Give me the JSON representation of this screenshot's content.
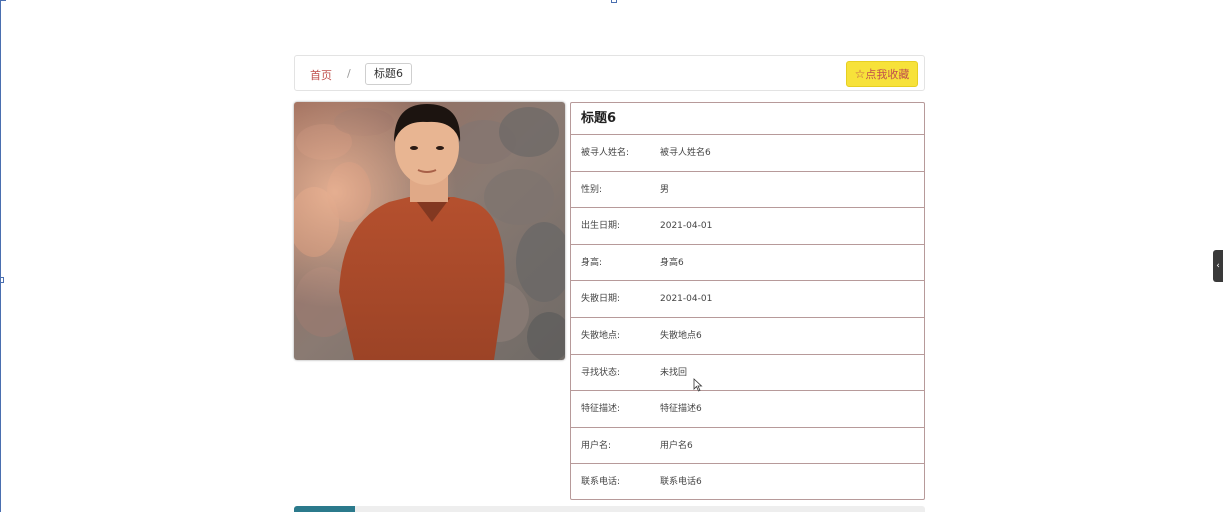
{
  "breadcrumb": {
    "home": "首页",
    "separator": "/",
    "current": "标题6"
  },
  "favorite_button": {
    "icon": "star-outline-icon",
    "label": "点我收藏"
  },
  "side_toggle": {
    "icon": "chevron-left-icon"
  },
  "detail": {
    "title": "标题6",
    "rows": [
      {
        "label": "被寻人姓名:",
        "value": "被寻人姓名6"
      },
      {
        "label": "性别:",
        "value": "男"
      },
      {
        "label": "出生日期:",
        "value": "2021-04-01"
      },
      {
        "label": "身高:",
        "value": "身高6"
      },
      {
        "label": "失散日期:",
        "value": "2021-04-01"
      },
      {
        "label": "失散地点:",
        "value": "失散地点6"
      },
      {
        "label": "寻找状态:",
        "value": "未找回"
      },
      {
        "label": "特征描述:",
        "value": "特征描述6"
      },
      {
        "label": "用户名:",
        "value": "用户名6"
      },
      {
        "label": "联系电话:",
        "value": "联系电话6"
      }
    ]
  },
  "colors": {
    "accent_red": "#c0504d",
    "fav_yellow": "#f7e23a",
    "table_border": "#b79a9a",
    "tab_active": "#2b7a8c"
  }
}
